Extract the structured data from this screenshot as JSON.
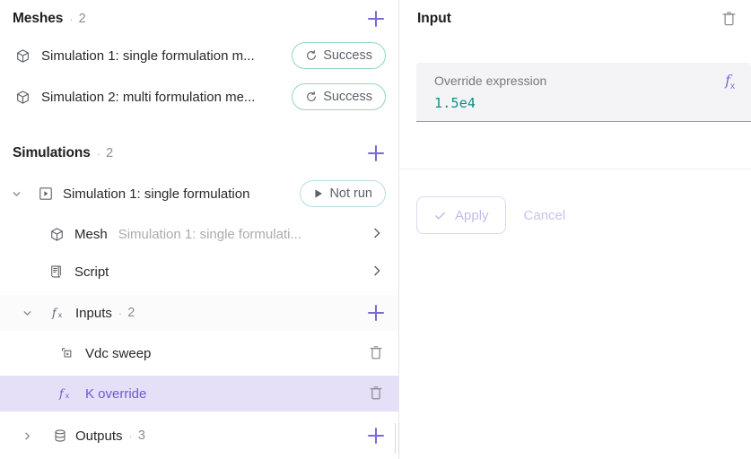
{
  "left": {
    "meshes": {
      "title": "Meshes",
      "separator": "·",
      "count": "2",
      "add_label": "+",
      "items": [
        {
          "icon": "cube-icon",
          "label": "Simulation 1: single formulation m...",
          "status": "Success",
          "status_icon": "rerun-icon"
        },
        {
          "icon": "cube-icon",
          "label": "Simulation 2: multi formulation me...",
          "status": "Success",
          "status_icon": "rerun-icon"
        }
      ]
    },
    "simulations": {
      "title": "Simulations",
      "separator": "·",
      "count": "2",
      "add_label": "+",
      "simulation": {
        "label": "Simulation 1: single formulation",
        "status": "Not run",
        "status_icon": "play-icon",
        "expanded": true
      },
      "mesh_row": {
        "label": "Mesh",
        "value": "Simulation 1: single formulati..."
      },
      "script_row": {
        "label": "Script"
      },
      "inputs_group": {
        "label": "Inputs",
        "separator": "·",
        "count": "2",
        "add_label": "+",
        "expanded": true,
        "items": [
          {
            "icon": "sweep-icon",
            "label": "Vdc sweep",
            "selected": false
          },
          {
            "icon": "fx-icon",
            "label": "K override",
            "selected": true
          }
        ]
      },
      "outputs_group": {
        "label": "Outputs",
        "separator": "·",
        "count": "3",
        "add_label": "+",
        "expanded": false
      }
    }
  },
  "right": {
    "title": "Input",
    "delete_icon": "trash-icon",
    "field": {
      "label": "Override expression",
      "value": "1.5e4",
      "fx_badge": "fx"
    },
    "apply_label": "Apply",
    "cancel_label": "Cancel"
  },
  "colors": {
    "accent": "#7b68d9",
    "selected_row_bg": "#e5e0f7",
    "selected_row_text": "#6d5ad0",
    "success_border": "#8fd9b6",
    "notrun_border": "#b9dbe8",
    "expression_value": "#0c8f85"
  }
}
